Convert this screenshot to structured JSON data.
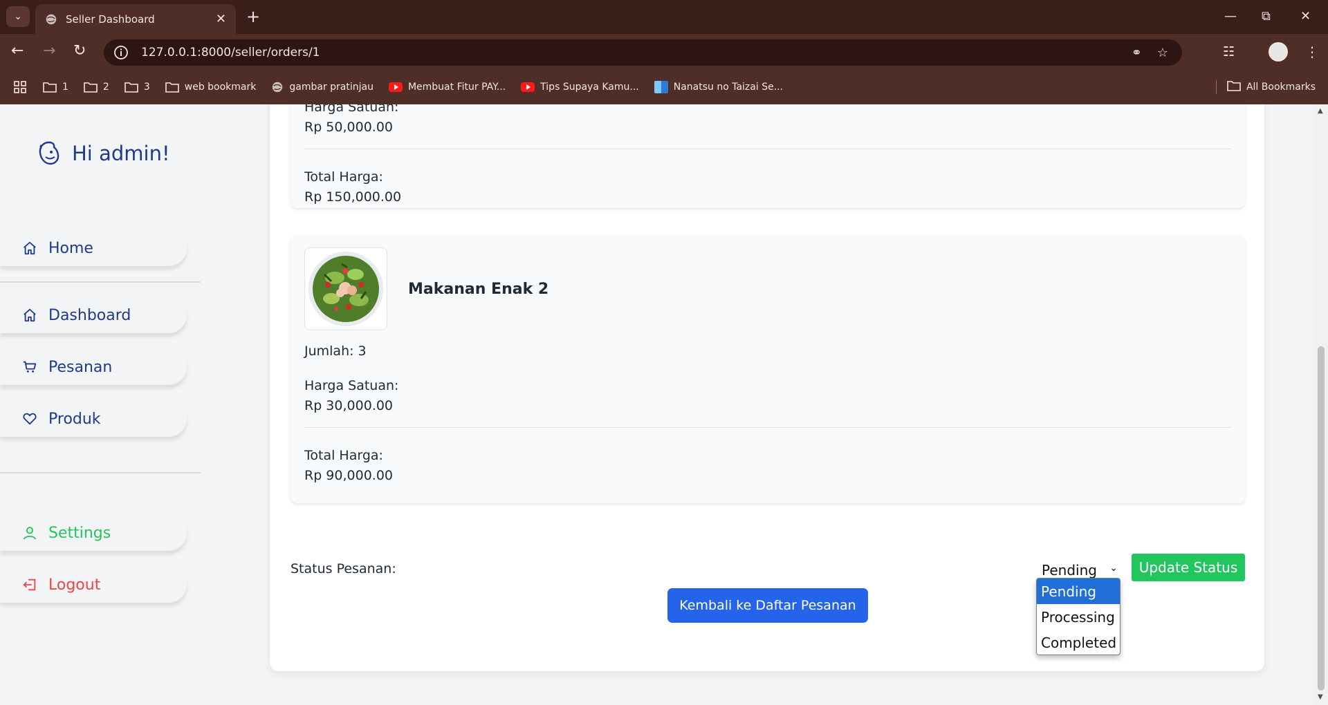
{
  "browser": {
    "tab_title": "Seller Dashboard",
    "url": "127.0.0.1:8000/seller/orders/1",
    "bookmarks": [
      {
        "label": "1",
        "icon": "folder-icon"
      },
      {
        "label": "2",
        "icon": "folder-icon"
      },
      {
        "label": "3",
        "icon": "folder-icon"
      },
      {
        "label": "web bookmark",
        "icon": "folder-icon"
      },
      {
        "label": "gambar pratinjau",
        "icon": "globe-icon"
      },
      {
        "label": "Membuat Fitur PAY...",
        "icon": "youtube-icon"
      },
      {
        "label": "Tips Supaya Kamu...",
        "icon": "youtube-icon"
      },
      {
        "label": "Nanatsu no Taizai Se...",
        "icon": "site-icon"
      }
    ],
    "all_bookmarks": "All Bookmarks"
  },
  "sidebar": {
    "greeting": "Hi admin!",
    "items": {
      "home": "Home",
      "dashboard": "Dashboard",
      "pesanan": "Pesanan",
      "produk": "Produk",
      "settings": "Settings",
      "logout": "Logout"
    }
  },
  "order": {
    "item1": {
      "unit_price_label": "Harga Satuan:",
      "unit_price": "Rp 50,000.00",
      "total_label": "Total Harga:",
      "total": "Rp 150,000.00"
    },
    "item2": {
      "name": "Makanan Enak 2",
      "qty_text": "Jumlah: 3",
      "unit_price_label": "Harga Satuan:",
      "unit_price": "Rp 30,000.00",
      "total_label": "Total Harga:",
      "total": "Rp 90,000.00"
    },
    "status_label": "Status Pesanan:",
    "status_selected": "Pending",
    "status_options": [
      "Pending",
      "Processing",
      "Completed"
    ],
    "update_button": "Update Status",
    "back_button": "Kembali ke Daftar Pesanan"
  },
  "colors": {
    "brand_blue": "#1e3a8a",
    "accent_green": "#22c55e",
    "danger_red": "#ef4444",
    "primary_button": "#2563eb"
  }
}
